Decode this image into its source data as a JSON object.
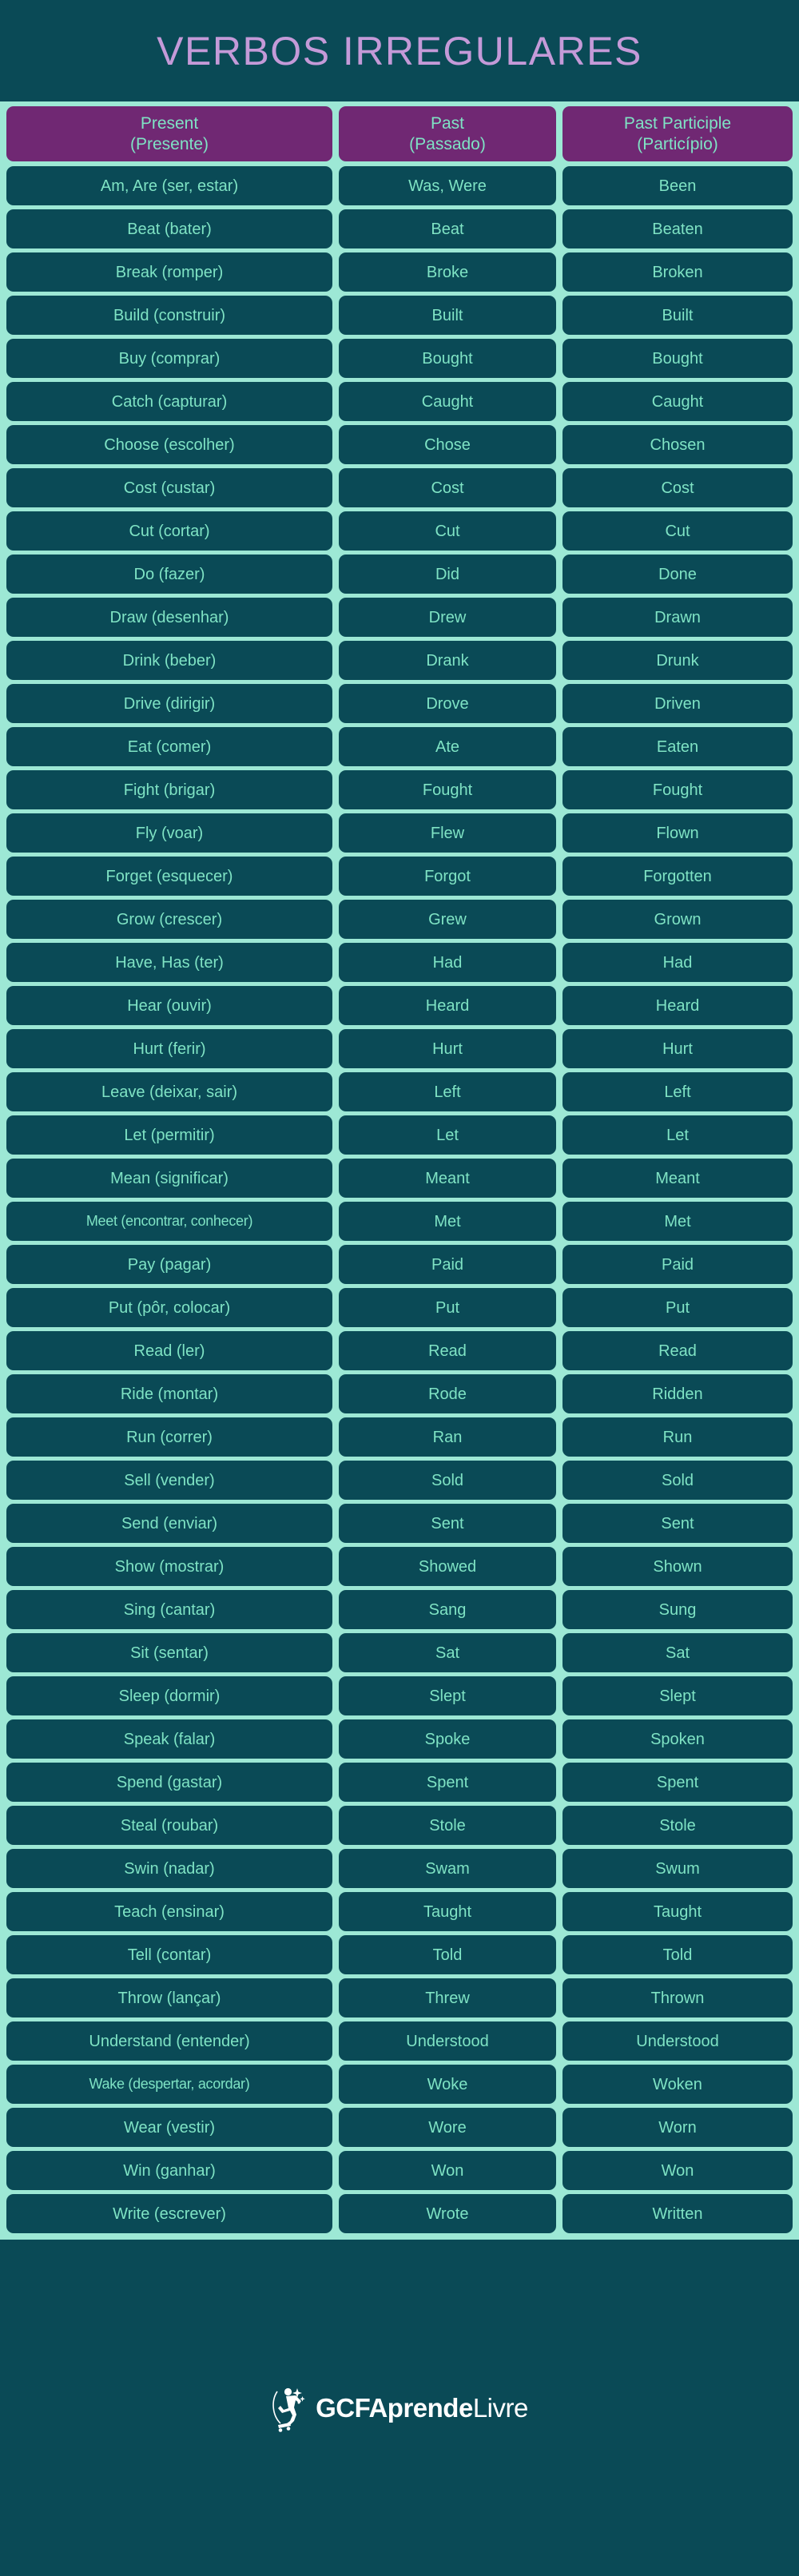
{
  "header": {
    "title": "VERBOS IRREGULARES",
    "title_color": "#c49ad8",
    "background_color": "#0a4a56"
  },
  "table": {
    "gap_color": "#9de8d5",
    "cell_color": "#0a4a56",
    "cell_text_color": "#7fe3c4",
    "header_color": "#702873",
    "columns": [
      {
        "en": "Present",
        "pt": "(Presente)"
      },
      {
        "en": "Past",
        "pt": "(Passado)"
      },
      {
        "en": "Past Participle",
        "pt": "(Particípio)"
      }
    ],
    "rows": [
      [
        "Am, Are (ser, estar)",
        "Was, Were",
        "Been"
      ],
      [
        "Beat (bater)",
        "Beat",
        "Beaten"
      ],
      [
        "Break (romper)",
        "Broke",
        "Broken"
      ],
      [
        "Build (construir)",
        "Built",
        "Built"
      ],
      [
        "Buy (comprar)",
        "Bought",
        "Bought"
      ],
      [
        "Catch (capturar)",
        "Caught",
        "Caught"
      ],
      [
        "Choose (escolher)",
        "Chose",
        "Chosen"
      ],
      [
        "Cost (custar)",
        "Cost",
        "Cost"
      ],
      [
        "Cut (cortar)",
        "Cut",
        "Cut"
      ],
      [
        "Do (fazer)",
        "Did",
        "Done"
      ],
      [
        "Draw (desenhar)",
        "Drew",
        "Drawn"
      ],
      [
        "Drink (beber)",
        "Drank",
        "Drunk"
      ],
      [
        "Drive (dirigir)",
        "Drove",
        "Driven"
      ],
      [
        "Eat (comer)",
        "Ate",
        "Eaten"
      ],
      [
        "Fight (brigar)",
        "Fought",
        "Fought"
      ],
      [
        "Fly (voar)",
        "Flew",
        "Flown"
      ],
      [
        "Forget (esquecer)",
        "Forgot",
        "Forgotten"
      ],
      [
        "Grow (crescer)",
        "Grew",
        "Grown"
      ],
      [
        "Have, Has (ter)",
        "Had",
        "Had"
      ],
      [
        "Hear (ouvir)",
        "Heard",
        "Heard"
      ],
      [
        "Hurt (ferir)",
        "Hurt",
        "Hurt"
      ],
      [
        "Leave (deixar, sair)",
        "Left",
        "Left"
      ],
      [
        "Let (permitir)",
        "Let",
        "Let"
      ],
      [
        "Mean (significar)",
        "Meant",
        "Meant"
      ],
      [
        "Meet (encontrar, conhecer)",
        "Met",
        "Met"
      ],
      [
        "Pay (pagar)",
        "Paid",
        "Paid"
      ],
      [
        "Put (pôr, colocar)",
        "Put",
        "Put"
      ],
      [
        "Read (ler)",
        "Read",
        "Read"
      ],
      [
        "Ride (montar)",
        "Rode",
        "Ridden"
      ],
      [
        "Run (correr)",
        "Ran",
        "Run"
      ],
      [
        "Sell (vender)",
        "Sold",
        "Sold"
      ],
      [
        "Send (enviar)",
        "Sent",
        "Sent"
      ],
      [
        "Show (mostrar)",
        "Showed",
        "Shown"
      ],
      [
        "Sing (cantar)",
        "Sang",
        "Sung"
      ],
      [
        "Sit (sentar)",
        "Sat",
        "Sat"
      ],
      [
        "Sleep (dormir)",
        "Slept",
        "Slept"
      ],
      [
        "Speak (falar)",
        "Spoke",
        "Spoken"
      ],
      [
        "Spend (gastar)",
        "Spent",
        "Spent"
      ],
      [
        "Steal (roubar)",
        "Stole",
        "Stole"
      ],
      [
        "Swin (nadar)",
        "Swam",
        "Swum"
      ],
      [
        "Teach (ensinar)",
        "Taught",
        "Taught"
      ],
      [
        "Tell (contar)",
        "Told",
        "Told"
      ],
      [
        "Throw (lançar)",
        "Threw",
        "Thrown"
      ],
      [
        "Understand (entender)",
        "Understood",
        "Understood"
      ],
      [
        "Wake (despertar, acordar)",
        "Woke",
        "Woken"
      ],
      [
        "Wear (vestir)",
        "Wore",
        "Worn"
      ],
      [
        "Win (ganhar)",
        "Won",
        "Won"
      ],
      [
        "Write (escrever)",
        "Wrote",
        "Written"
      ]
    ]
  },
  "footer": {
    "logo_icon": "gcf-skater-icon",
    "brand_bold": "GCFAprende",
    "brand_light": "Livre",
    "text_color": "#ffffff",
    "background_color": "#0a4a56"
  }
}
